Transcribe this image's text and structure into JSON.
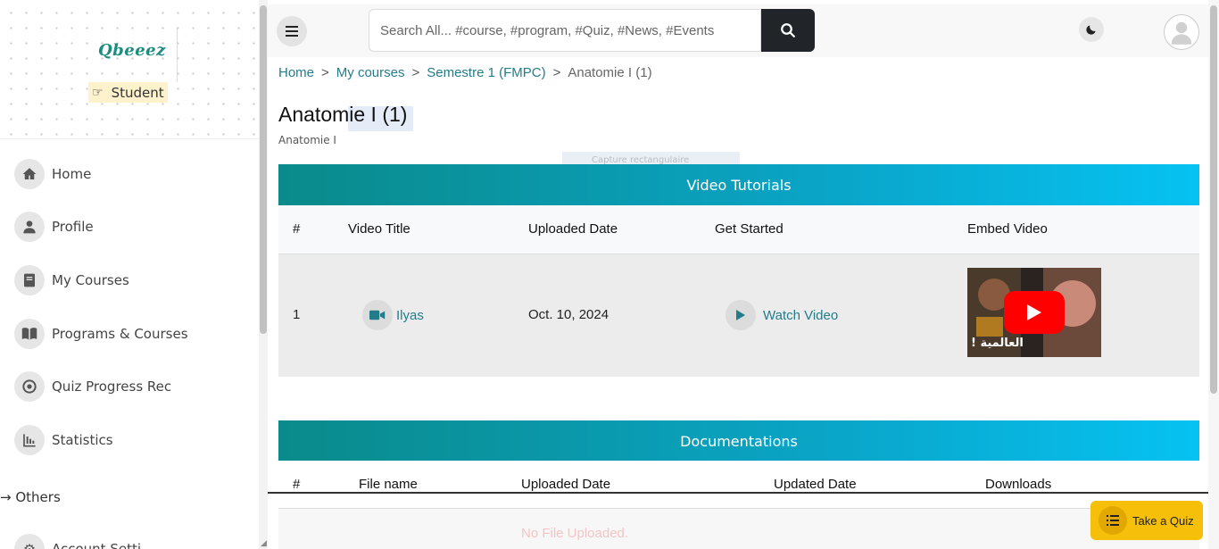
{
  "brand": {
    "logo_text": "Qbeeez",
    "role": "Student"
  },
  "sidebar": {
    "items": [
      {
        "label": "Home",
        "icon": "home-icon"
      },
      {
        "label": "Profile",
        "icon": "user-icon"
      },
      {
        "label": "My Courses",
        "icon": "book-icon"
      },
      {
        "label": "Programs & Courses",
        "icon": "open-book-icon"
      },
      {
        "label": "Quiz Progress Rec",
        "icon": "target-icon"
      },
      {
        "label": "Statistics",
        "icon": "chart-icon"
      }
    ],
    "others_label": "Others",
    "next_item_partial": "Account Setti..."
  },
  "topbar": {
    "search_placeholder": "Search All... #course, #program, #Quiz, #News, #Events"
  },
  "breadcrumb": {
    "home": "Home",
    "my_courses": "My courses",
    "semester": "Semestre 1 (FMPC)",
    "current": "Anatomie I (1)",
    "separator": ">"
  },
  "page": {
    "title": "Anatomie I (1)",
    "subtitle": "Anatomie I",
    "ghost_tooltip": "Capture rectangulaire"
  },
  "video_section": {
    "title": "Video Tutorials",
    "columns": [
      "#",
      "Video Title",
      "Uploaded Date",
      "Get Started",
      "Embed Video"
    ],
    "rows": [
      {
        "index": "1",
        "title": "Ilyas",
        "uploaded": "Oct. 10, 2024",
        "action": "Watch Video",
        "thumb_caption": "العالمية !"
      }
    ]
  },
  "doc_section": {
    "title": "Documentations",
    "columns": [
      "#",
      "File name",
      "Uploaded Date",
      "Updated Date",
      "Downloads"
    ],
    "empty_message": "No File Uploaded."
  },
  "quiz_button": {
    "label": "Take a Quiz"
  },
  "colors": {
    "accent": "#237c8a",
    "header_gradient_start": "#0a8a8a",
    "header_gradient_end": "#06c2f2",
    "quiz_button": "#f5bf0a"
  }
}
